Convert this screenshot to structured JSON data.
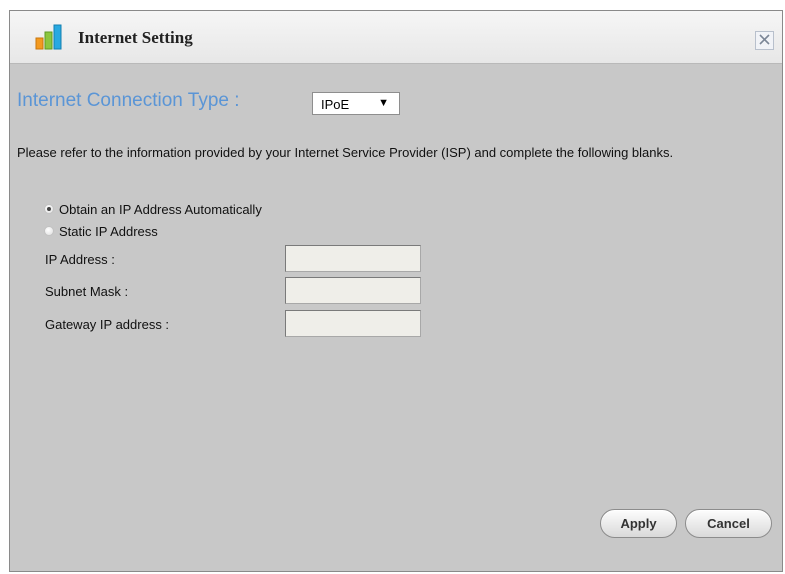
{
  "window": {
    "title": "Internet Setting"
  },
  "connection": {
    "heading": "Internet Connection Type :",
    "selected_type": "IPoE"
  },
  "info_text": "Please refer to the information provided by your Internet Service Provider (ISP) and complete the following blanks.",
  "ip_mode": {
    "options": [
      "Obtain an IP Address Automatically",
      "Static IP Address"
    ],
    "selected": "Obtain an IP Address Automatically"
  },
  "fields": {
    "ip_address": {
      "label": "IP Address :",
      "value": ""
    },
    "subnet_mask": {
      "label": "Subnet Mask :",
      "value": ""
    },
    "gateway": {
      "label": "Gateway IP address :",
      "value": ""
    }
  },
  "buttons": {
    "apply": "Apply",
    "cancel": "Cancel"
  },
  "colors": {
    "heading": "#5a95d6",
    "panel": "#c8c8c8",
    "input_bg": "#efeee9"
  }
}
